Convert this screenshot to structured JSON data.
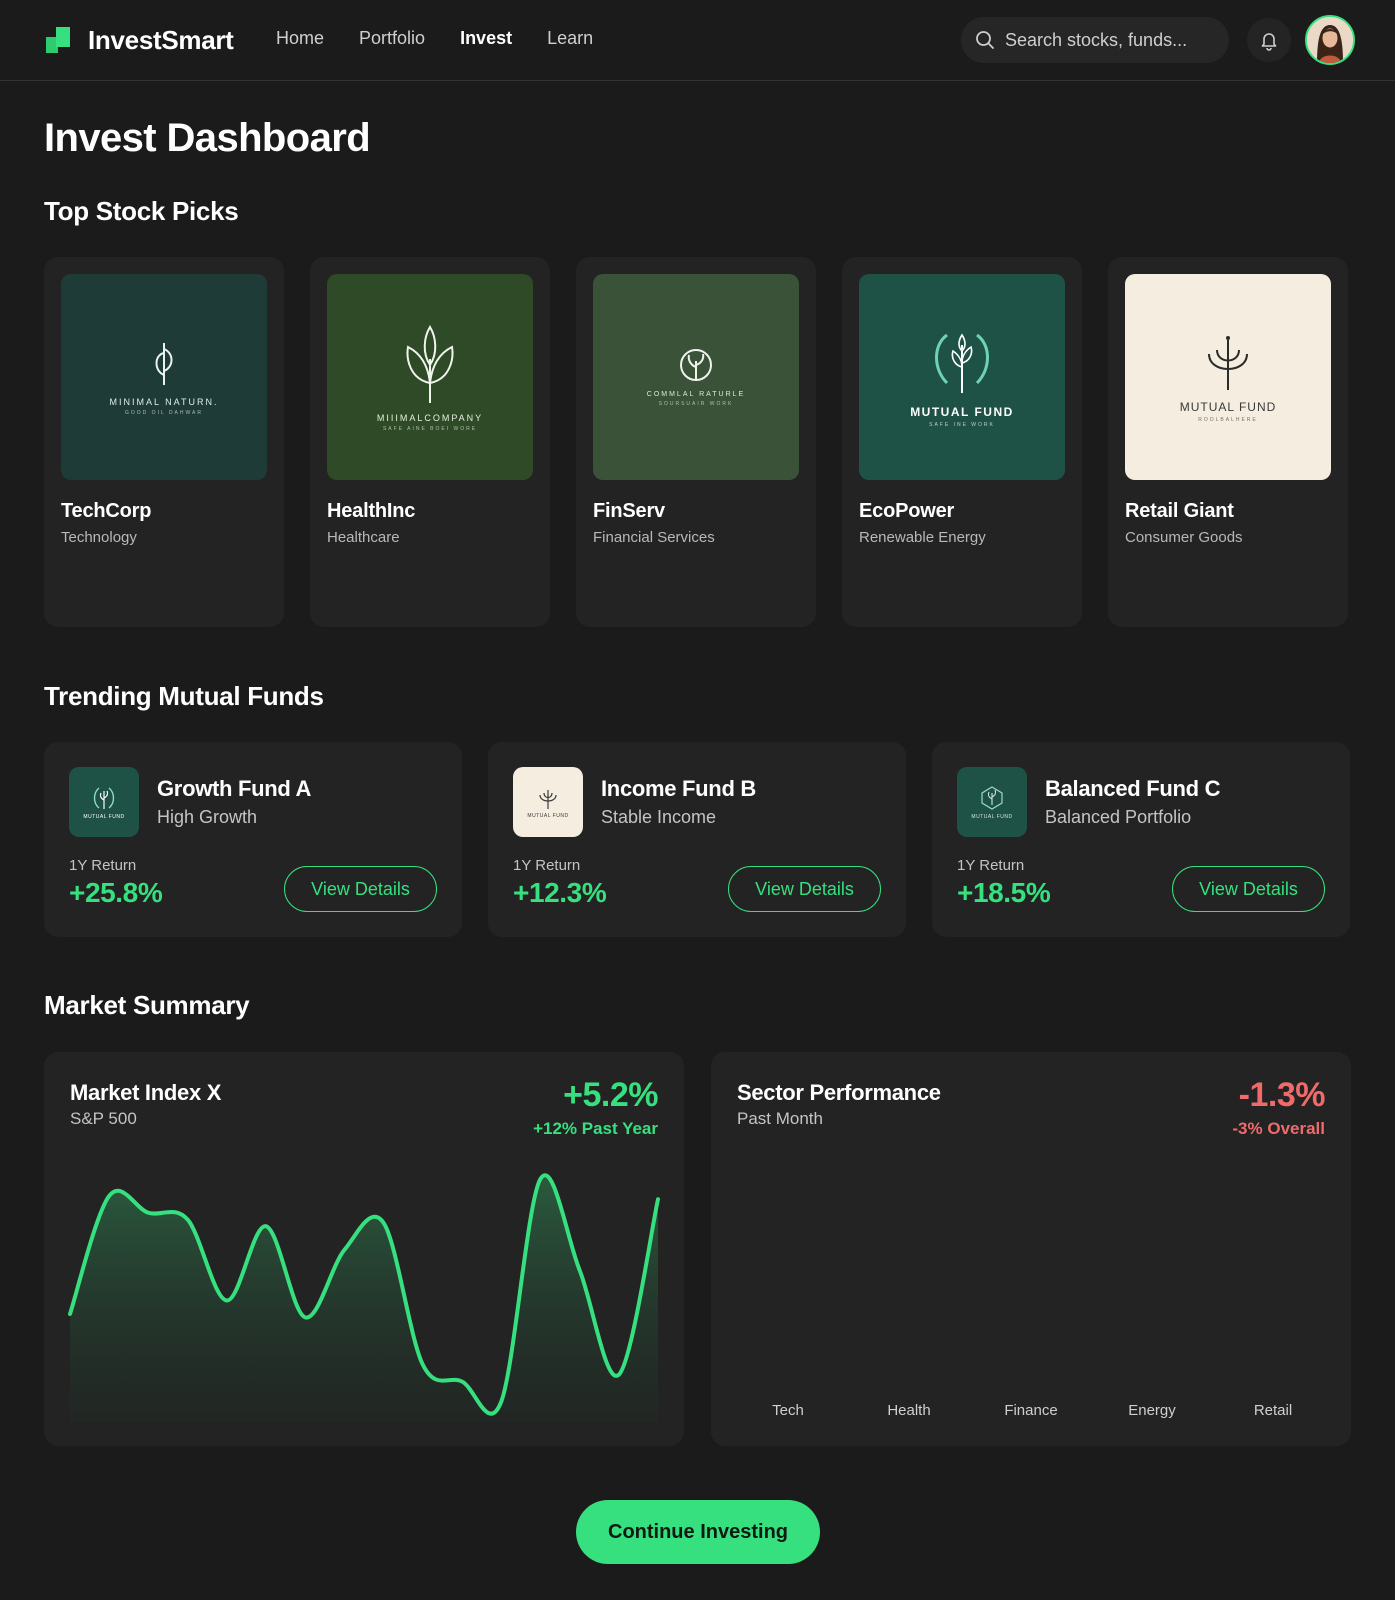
{
  "header": {
    "brand": "InvestSmart",
    "nav": [
      "Home",
      "Portfolio",
      "Invest",
      "Learn"
    ],
    "active_nav": "Invest",
    "search_placeholder": "Search stocks, funds...",
    "accent": "#36e07f"
  },
  "page_title": "Invest Dashboard",
  "stocks_section": {
    "title": "Top Stock Picks",
    "items": [
      {
        "name": "TechCorp",
        "sector": "Technology",
        "logo_text": "MINIMAL NATURN.",
        "logo_sub": "GOOD OIL DAHWAR",
        "logo_bg": "#1f3b37",
        "icon": "leaf-stem-icon"
      },
      {
        "name": "HealthInc",
        "sector": "Healthcare",
        "logo_text": "MIIIMALCOMPANY",
        "logo_sub": "SAFE AINE BOEI WORE",
        "logo_bg": "#2e4a26",
        "icon": "sprout-icon"
      },
      {
        "name": "FinServ",
        "sector": "Financial Services",
        "logo_text": "COMMLAL RATURLE",
        "logo_sub": "SOURSUAIR WORK",
        "logo_bg": "#3a5238",
        "icon": "circle-leaf-icon"
      },
      {
        "name": "EcoPower",
        "sector": "Renewable Energy",
        "logo_text": "MUTUAL FUND",
        "logo_sub": "SAFE INE WORK",
        "logo_bg": "#1f5247",
        "icon": "wreath-tree-icon"
      },
      {
        "name": "Retail Giant",
        "sector": "Consumer Goods",
        "logo_text": "MUTUAL FUND",
        "logo_sub": "ROOLBALHERE",
        "logo_bg": "#f4ede0",
        "icon": "trident-plant-icon"
      }
    ]
  },
  "funds_section": {
    "title": "Trending Mutual Funds",
    "items": [
      {
        "name": "Growth Fund A",
        "subtitle": "High Growth",
        "return_label": "1Y Return",
        "return": "+25.8%",
        "button": "View Details",
        "logo_text": "MUTUAL FUND",
        "logo_bg": "#1f5247"
      },
      {
        "name": "Income Fund B",
        "subtitle": "Stable Income",
        "return_label": "1Y Return",
        "return": "+12.3%",
        "button": "View Details",
        "logo_text": "MUTUAL FUND",
        "logo_bg": "#f4ede0"
      },
      {
        "name": "Balanced Fund C",
        "subtitle": "Balanced Portfolio",
        "return_label": "1Y Return",
        "return": "+18.5%",
        "button": "View Details",
        "logo_text": "MUTUAL FUND",
        "logo_bg": "#1f5247"
      }
    ]
  },
  "market_section": {
    "title": "Market Summary",
    "index_card": {
      "title": "Market Index X",
      "subtitle": "S&P 500",
      "change": "+5.2%",
      "change_sub": "+12% Past Year"
    },
    "sector_card": {
      "title": "Sector Performance",
      "subtitle": "Past Month",
      "change": "-1.3%",
      "change_sub": "-3% Overall",
      "categories": [
        "Tech",
        "Health",
        "Finance",
        "Energy",
        "Retail"
      ]
    }
  },
  "chart_data": {
    "type": "area",
    "title": "Market Index X",
    "series": [
      {
        "values": [
          32,
          67,
          62,
          60,
          36,
          58,
          31,
          51,
          59,
          17,
          12,
          6,
          72,
          45,
          14,
          66
        ]
      }
    ],
    "color": "#36e07f",
    "grid": false,
    "ylim": [
      0,
      80
    ]
  },
  "cta_label": "Continue Investing"
}
